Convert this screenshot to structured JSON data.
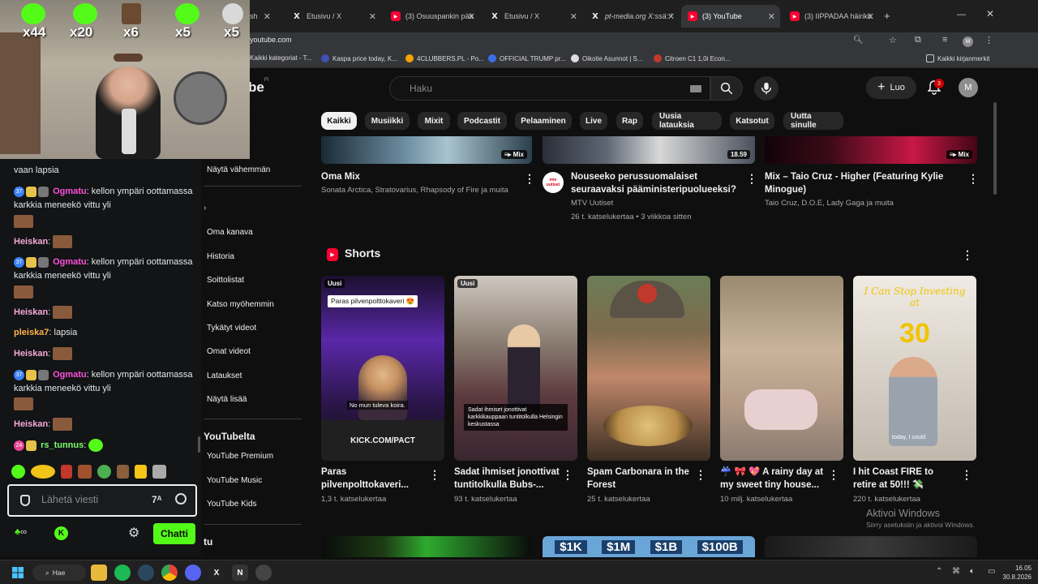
{
  "tabs": [
    {
      "label": "Etusivu / X",
      "icon": "x-icon"
    },
    {
      "label": "(3) Osuuspankin pää",
      "icon": "youtube-icon"
    },
    {
      "label": "Etusivu / X",
      "icon": "x-icon"
    },
    {
      "label": "pt-media.org X:ssä: '",
      "icon": "x-icon"
    },
    {
      "label": "(3) YouTube",
      "icon": "youtube-icon"
    },
    {
      "label": "(3) IIPPADAA häirikö",
      "icon": "youtube-icon"
    }
  ],
  "url": "youtube.com",
  "bookmarks": [
    {
      "label": "Kaikki kategoriat - T..."
    },
    {
      "label": "Kaspa price today, K..."
    },
    {
      "label": "4CLUBBERS.PL - Po..."
    },
    {
      "label": "OFFICIAL TRUMP pr..."
    },
    {
      "label": "Oikotie Asunnot | S..."
    },
    {
      "label": "Citroen C1 1,0i Econ..."
    }
  ],
  "bookmarks_all": "Kaikki kirjanmerkit",
  "yt": {
    "search_placeholder": "Haku",
    "create_label": "Luo",
    "notif_count": "3",
    "avatar_letter": "M",
    "chips": [
      "Kaikki",
      "Musiikki",
      "Mixit",
      "Podcastit",
      "Pelaaminen",
      "Live",
      "Rap",
      "Uusia latauksia",
      "Katsotut",
      "Uutta sinulle"
    ],
    "sidebar": {
      "show_less": "Näytä vähemmän",
      "you_items": [
        "Oma kanava",
        "Historia",
        "Soittolistat",
        "Katso myöhemmin",
        "Tykätyt videot",
        "Omat videot",
        "Lataukset",
        "Näytä lisää"
      ],
      "more_heading": "YouTubelta",
      "more_items": [
        "YouTube Premium",
        "YouTube Music",
        "YouTube Kids"
      ],
      "bottom_partial": "tu"
    },
    "top_videos": [
      {
        "title": "Oma Mix",
        "meta1": "Sonata Arctica, Stratovarius, Rhapsody of Fire ja muita",
        "meta2": "",
        "badge": "Mix"
      },
      {
        "title": "Nouseeko perussuomalaiset seuraavaksi pääministeripuolueeksi?",
        "meta1": "MTV Uutiset",
        "meta2": "26 t. katselukertaa • 3 viikkoa sitten",
        "badge": "18.59",
        "channel_logo": "mtv uutiset"
      },
      {
        "title": "Mix – Taio Cruz - Higher (Featuring Kylie Minogue)",
        "meta1": "Taio Cruz, D.O.E, Lady Gaga ja muita",
        "meta2": "",
        "badge": "Mix"
      }
    ],
    "shorts_heading": "Shorts",
    "shorts": [
      {
        "title": "Paras pilvenpolttokaveri...",
        "views": "1,3 t. katselukertaa",
        "new": "Uusi",
        "caption": "Paras pilvenpolttokaveri 😍",
        "sub": "No mun tuleva koira.",
        "ad": "KICK.COM/PACT"
      },
      {
        "title": "Sadat ihmiset jonottivat tuntitolkulla Bubs-...",
        "views": "93 t. katselukertaa",
        "new": "Uusi",
        "caption": "Sadat ihmiset jonottivat karkkikauppaan tuntitolkulla Helsingin keskustassa"
      },
      {
        "title": "Spam Carbonara in the Forest",
        "views": "25 t. katselukertaa"
      },
      {
        "title": "☔ 🎀 💖 A rainy day at my sweet tiny house...",
        "views": "10 milj. katselukertaa"
      },
      {
        "title": "I hit Coast FIRE to retire at 50!!! 💸",
        "views": "220 t. katselukertaa",
        "overlay_top": "I Can Stop Investing at",
        "overlay_num": "30",
        "overlay_bottom": "today, I could"
      }
    ],
    "bottom_row_labels": [
      "$1K",
      "$1M",
      "$1B",
      "$100B"
    ]
  },
  "chat": {
    "lines": [
      {
        "name": "",
        "text": "vaan lapsia",
        "color": "#e7e7e7"
      },
      {
        "badge": "37",
        "name": "Ogmatu",
        "text": "kellon ympäri oottamassa karkkia meneekö vittu yli",
        "color": "#ff4fd8"
      },
      {
        "name": "Heiskan",
        "text": "",
        "color": "#f5a8d8"
      },
      {
        "badge": "37",
        "name": "Ogmatu",
        "text": "kellon ympäri oottamassa karkkia meneekö vittu yli",
        "color": "#ff4fd8"
      },
      {
        "name": "Heiskan",
        "text": "",
        "color": "#f5a8d8"
      },
      {
        "name": "pleiska7",
        "text": "lapsia",
        "color": "#ffb347"
      },
      {
        "name": "Heiskan",
        "text": "",
        "color": "#f5a8d8"
      },
      {
        "badge": "37",
        "name": "Ogmatu",
        "text": "kellon ympäri oottamassa karkkia meneekö vittu yli",
        "color": "#ff4fd8"
      },
      {
        "name": "Heiskan",
        "text": "",
        "color": "#f5a8d8"
      },
      {
        "badge": "24",
        "name": "rs_tunnus",
        "text": "",
        "color": "#7bff6a"
      }
    ],
    "input_placeholder": "Lähetä viesti",
    "send_label": "Chatti"
  },
  "webcam": {
    "counters": [
      "x44",
      "x20",
      "x6",
      "x5",
      "x5"
    ]
  },
  "windows_activation": {
    "title": "Aktivoi Windows",
    "subtitle": "Siirry asetuksiin ja aktivoi Windows."
  },
  "taskbar": {
    "search_label": "Hae",
    "time": "16.05",
    "date": "30.8.2026"
  },
  "colors": {
    "kick_green": "#53fc18",
    "yt_red": "#ff0033",
    "bg": "#0f0f0f"
  }
}
